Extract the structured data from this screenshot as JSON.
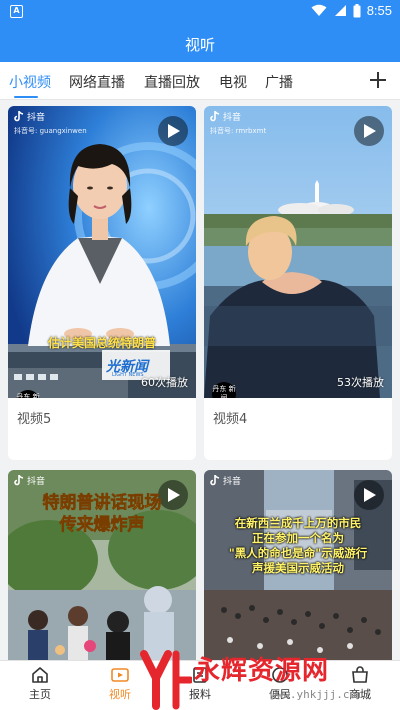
{
  "status": {
    "time": "8:55",
    "app_badge": "A"
  },
  "header": {
    "title": "视听"
  },
  "tabs": [
    {
      "label": "小视频",
      "active": true
    },
    {
      "label": "网络直播"
    },
    {
      "label": "直播回放"
    },
    {
      "label": "电视"
    },
    {
      "label": "广播"
    }
  ],
  "videos": [
    {
      "title": "视频5",
      "views": "60次播放",
      "tiktok_label": "抖音",
      "tiktok_id": "抖音号: guangxinwen",
      "caption": "估计美国总统特朗普",
      "brand": "光新闻",
      "brand_sub": "LIGHT NEWS",
      "badge": "丹东 新闻"
    },
    {
      "title": "视频4",
      "views": "53次播放",
      "tiktok_label": "抖音",
      "tiktok_id": "抖音号: rmrbxmt",
      "badge": "丹东 新闻"
    },
    {
      "title": "",
      "tiktok_label": "抖音",
      "tiktok_id": "",
      "caption_lines": [
        "特朗普讲话现场",
        "传来爆炸声"
      ]
    },
    {
      "title": "",
      "tiktok_label": "抖音",
      "tiktok_id": "",
      "caption_lines": [
        "在新西兰成千上万的市民",
        "正在参加一个名为",
        "\"黑人的命也是命\"示威游行",
        "声援美国示威活动"
      ]
    }
  ],
  "bottom_nav": [
    {
      "label": "主页",
      "icon": "home-icon"
    },
    {
      "label": "视听",
      "icon": "video-icon",
      "active": true
    },
    {
      "label": "报料",
      "icon": "report-icon"
    },
    {
      "label": "便民",
      "icon": "service-icon"
    },
    {
      "label": "商城",
      "icon": "shop-icon"
    }
  ],
  "watermark": {
    "text": "永辉资源网",
    "url": "www.yhkjjj.com"
  },
  "colors": {
    "primary": "#2f8ef6",
    "active_nav": "#f08a26",
    "watermark": "#e5262d"
  }
}
